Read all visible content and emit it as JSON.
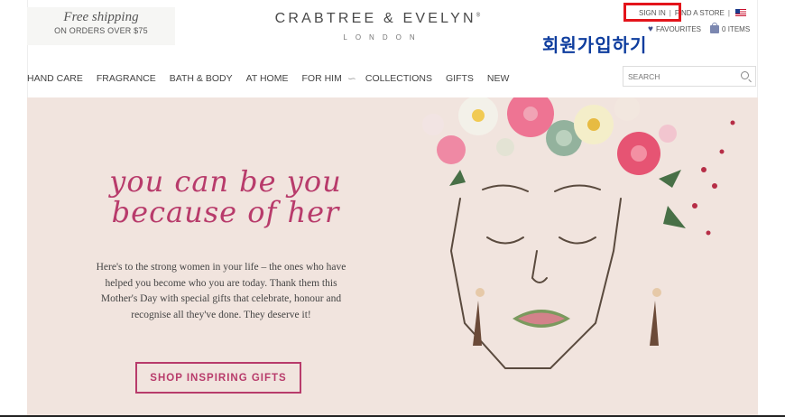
{
  "promo": {
    "title": "Free shipping",
    "subtitle": "ON ORDERS OVER $75"
  },
  "logo": {
    "name": "CRABTREE & EVELYN",
    "tm": "®",
    "location": "LONDON"
  },
  "utility": {
    "sign_in": "SIGN IN",
    "find_store": "FIND A STORE",
    "separator": "|"
  },
  "overlay": {
    "korean_text": "회원가입하기",
    "highlight_color": "#e3141b"
  },
  "mini_cart": {
    "favourites": "FAVOURITES",
    "items": "0 ITEMS"
  },
  "nav": {
    "items": [
      "HAND CARE",
      "FRAGRANCE",
      "BATH & BODY",
      "AT HOME",
      "FOR HIM",
      "COLLECTIONS",
      "GIFTS",
      "NEW"
    ]
  },
  "search": {
    "placeholder": "SEARCH"
  },
  "hero": {
    "headline_line1": "you can be you",
    "headline_line2": "because of her",
    "body": "Here's to the strong women in your life – the ones who have helped you become who you are today. Thank them this Mother's Day with special gifts that celebrate, honour and recognise all they've done. They deserve it!",
    "cta": "SHOP INSPIRING GIFTS",
    "accent_color": "#b83b6b",
    "background_color": "#f1e4de"
  }
}
